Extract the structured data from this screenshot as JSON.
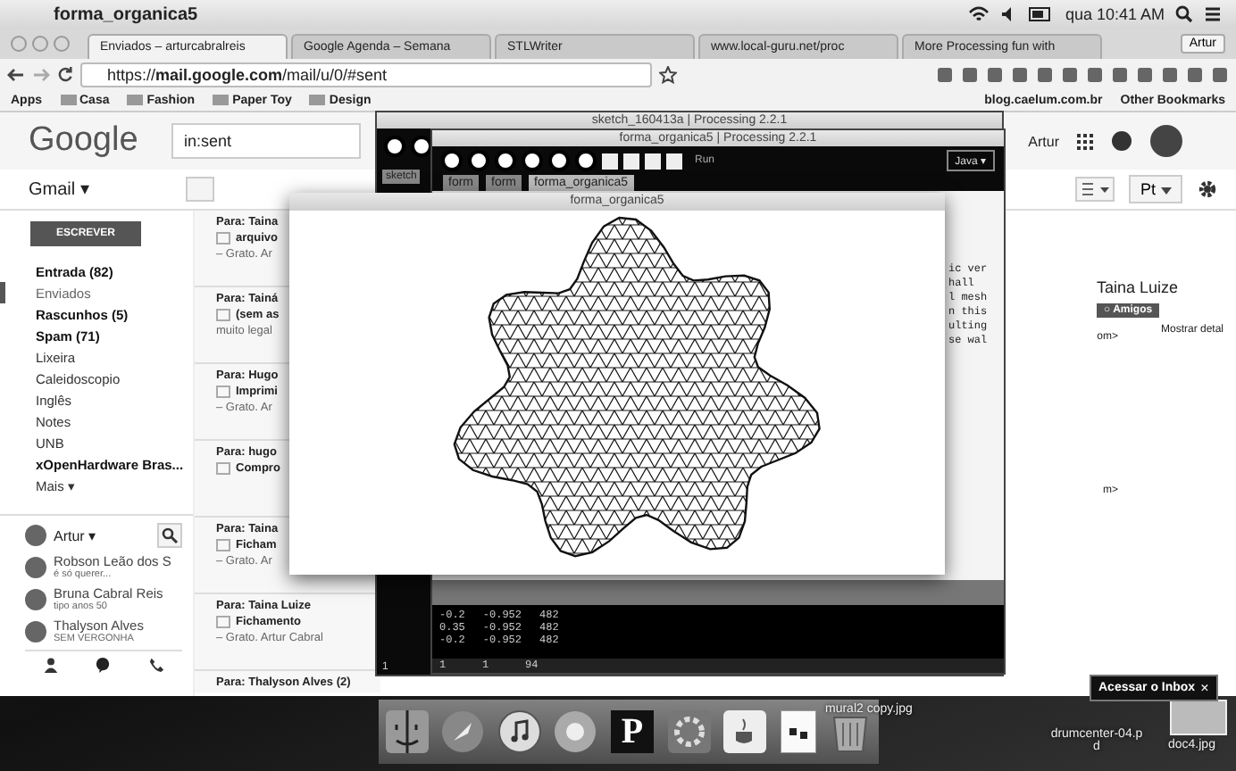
{
  "menu_bar": {
    "app": "forma_organica5",
    "clock": "qua 10:41 AM"
  },
  "browser": {
    "tabs": [
      {
        "label": "Enviados – arturcabralreis",
        "selected": true
      },
      {
        "label": "Google Agenda – Semana",
        "selected": false
      },
      {
        "label": "STLWriter",
        "selected": false
      },
      {
        "label": "www.local-guru.net/proc",
        "selected": false
      },
      {
        "label": "More Processing fun with",
        "selected": false
      }
    ],
    "profile": "Artur",
    "url": {
      "scheme": "https://",
      "host": "mail.google.com",
      "path": "/mail/u/0/#sent"
    },
    "bookmarks": [
      "Apps",
      "Casa",
      "Fashion",
      "Paper Toy",
      "Design"
    ],
    "bookmarks_right": [
      "blog.caelum.com.br",
      "Other Bookmarks"
    ]
  },
  "gmail": {
    "logo": "Google",
    "search": "in:sent",
    "user": "Artur",
    "app_menu": "Gmail ▾",
    "language": "Pt",
    "compose": "ESCREVER",
    "labels": [
      {
        "label": "Entrada (82)",
        "bold": true,
        "selected": false
      },
      {
        "label": "Enviados",
        "bold": false,
        "selected": true
      },
      {
        "label": "Rascunhos (5)",
        "bold": true,
        "selected": false
      },
      {
        "label": "Spam (71)",
        "bold": true,
        "selected": false
      },
      {
        "label": "Lixeira",
        "bold": false,
        "selected": false
      },
      {
        "label": "Caleidoscopio",
        "bold": false,
        "selected": false
      },
      {
        "label": "Inglês",
        "bold": false,
        "selected": false
      },
      {
        "label": "Notes",
        "bold": false,
        "selected": false
      },
      {
        "label": "UNB",
        "bold": false,
        "selected": false
      },
      {
        "label": "xOpenHardware Bras...",
        "bold": true,
        "selected": false
      }
    ],
    "more": "Mais ▾",
    "chat": {
      "me": "Artur ▾",
      "contacts": [
        {
          "name": "Robson Leão dos S",
          "status": "é só querer..."
        },
        {
          "name": "Bruna Cabral Reis",
          "status": "tipo anos 50"
        },
        {
          "name": "Thalyson Alves",
          "status": "SEM VERGONHA"
        }
      ]
    },
    "select_all_checked": false,
    "messages": [
      {
        "to": "Para: Taina",
        "subject": "arquivo",
        "snippet": "– Grato. Ar",
        "checked": false
      },
      {
        "to": "Para: Tainá",
        "subject": "(sem as",
        "snippet": "muito legal",
        "checked": false
      },
      {
        "to": "Para: Hugo",
        "subject": "Imprimi",
        "snippet": "– Grato. Ar",
        "checked": false
      },
      {
        "to": "Para: hugo",
        "subject": "Compro",
        "checked": false
      },
      {
        "to": "Para: Taina",
        "subject": "Ficham",
        "snippet": "– Grato. Ar",
        "checked": false
      },
      {
        "to": "Para: Taina Luize",
        "subject": "Fichamento",
        "snippet": "– Grato. Artur Cabral",
        "checked": false
      },
      {
        "to": "Para: Thalyson Alves (2)"
      }
    ],
    "message_fragments": [
      "om>",
      "m>"
    ],
    "contact": {
      "name": "Taina Luize",
      "group": "○ Amigos",
      "details": "Mostrar detal"
    }
  },
  "processing": {
    "back_title": "sketch_160413a | Processing 2.2.1",
    "back_tab": "sketch",
    "title": "forma_organica5 | Processing 2.2.1",
    "run_label": "Run",
    "mode": "Java ▾",
    "tabs": [
      {
        "label": "form",
        "selected": false
      },
      {
        "label": "form",
        "selected": false
      },
      {
        "label": "forma_organica5",
        "selected": true
      }
    ],
    "code_fragments": [
      "ic ver",
      "hall",
      "l mesh",
      "n this",
      "ulting",
      "se wal"
    ],
    "console": [
      [
        "-0.2",
        "-0.952",
        "482"
      ],
      [
        "0.35",
        "-0.952",
        "482"
      ],
      [
        "-0.2",
        "-0.952",
        "482"
      ]
    ],
    "line_number": "1",
    "status": [
      "1",
      "1",
      "94"
    ]
  },
  "sketch_window": {
    "title": "forma_organica5"
  },
  "dock": {
    "processing_letter": "P"
  },
  "desktop": {
    "files": [
      "mural2 copy.jpg",
      "drumcenter-04.pd",
      "doc4.jpg"
    ],
    "tooltip": "Acessar o Inbox",
    "tooltip_close": "×"
  }
}
